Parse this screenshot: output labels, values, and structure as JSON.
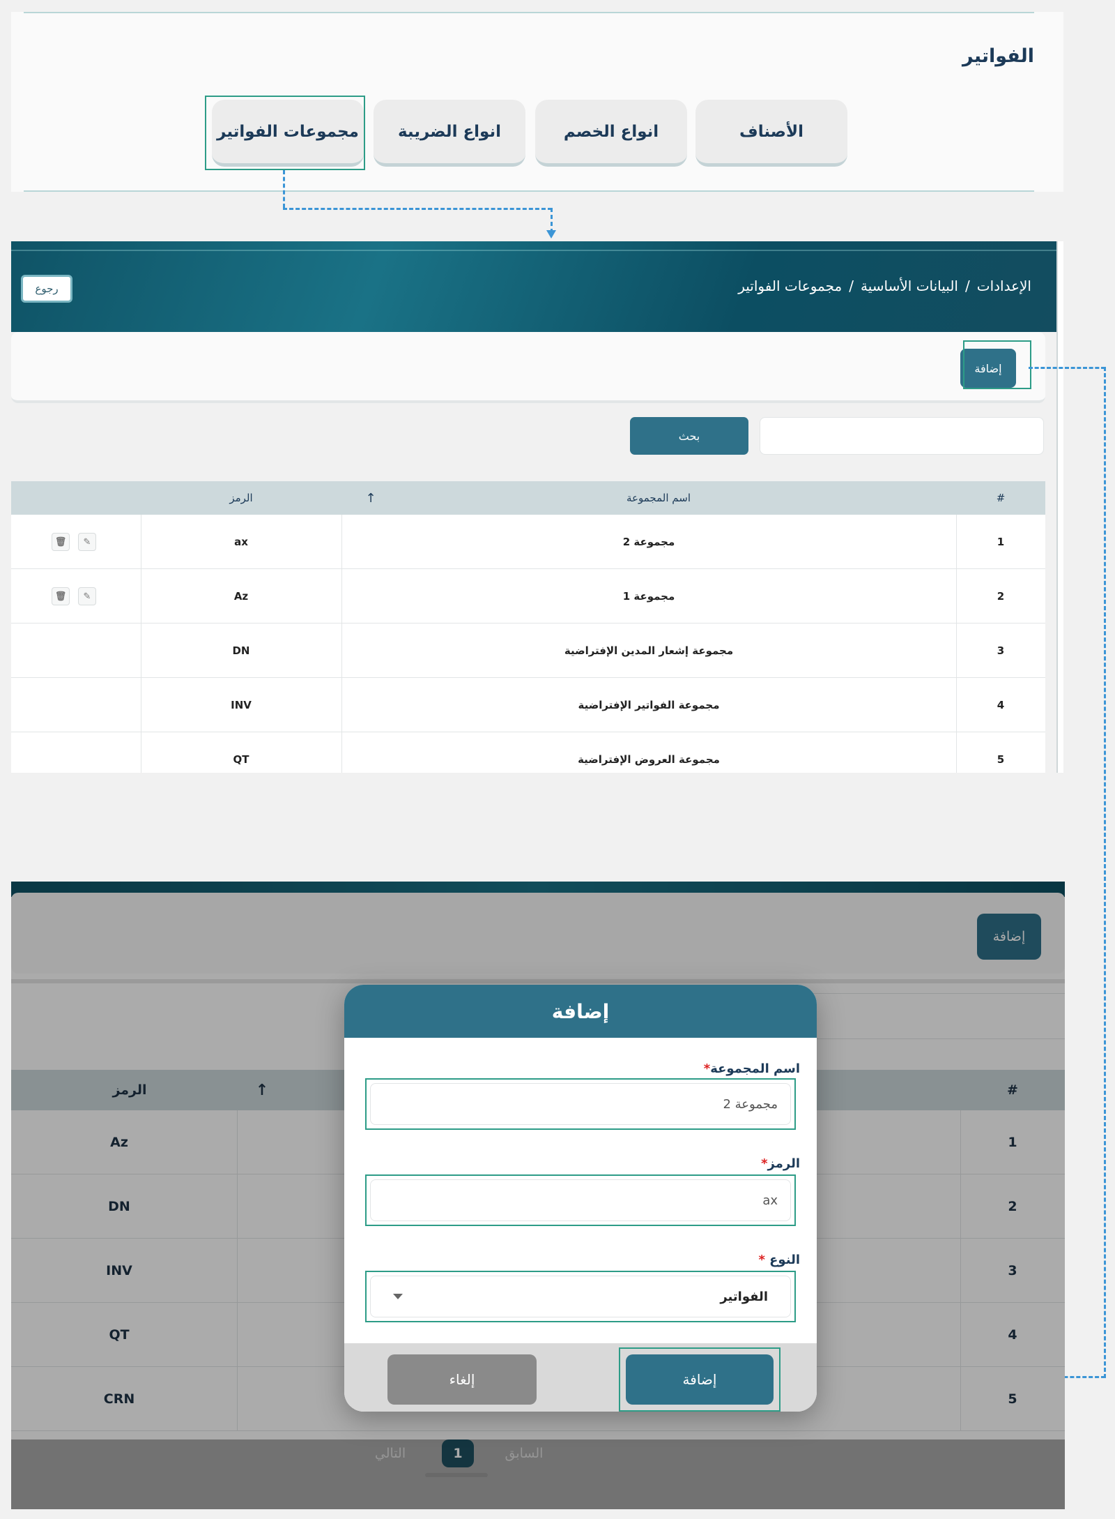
{
  "section1": {
    "title": "الفواتير",
    "tabs": [
      "الأصناف",
      "انواع الخصم",
      "انواع الضريبة",
      "مجموعات الفواتير"
    ]
  },
  "section2": {
    "breadcrumb": [
      "الإعدادات",
      "البيانات الأساسية",
      "مجموعات الفواتير"
    ],
    "breadcrumb_sep": "/",
    "back_label": "رجوع",
    "add_label": "إضافة",
    "search_label": "بحث",
    "search_placeholder": "",
    "columns": {
      "index": "#",
      "name": "اسم المجموعة",
      "sort_icon": "↑",
      "code": "الرمز"
    },
    "rows": [
      {
        "index": "1",
        "name": "مجموعة 2",
        "code": "ax",
        "actions": true
      },
      {
        "index": "2",
        "name": "مجموعة 1",
        "code": "Az",
        "actions": true
      },
      {
        "index": "3",
        "name": "مجموعة إشعار المدين الإفتراضية",
        "code": "DN",
        "actions": false
      },
      {
        "index": "4",
        "name": "مجموعة الفواتير الإفتراضية",
        "code": "INV",
        "actions": false
      },
      {
        "index": "5",
        "name": "مجموعة العروض الإفتراضية",
        "code": "QT",
        "actions": false
      }
    ]
  },
  "section3": {
    "add_label": "إضافة",
    "columns": {
      "index": "#",
      "sort_icon": "↑",
      "code": "الرمز"
    },
    "rows": [
      {
        "index": "1",
        "code": "Az"
      },
      {
        "index": "2",
        "code": "DN"
      },
      {
        "index": "3",
        "code": "INV"
      },
      {
        "index": "4",
        "code": "QT"
      },
      {
        "index": "5",
        "code": "CRN"
      }
    ],
    "pager": {
      "prev": "السابق",
      "page": "1",
      "next": "التالي"
    }
  },
  "modal": {
    "title": "إضافة",
    "fields": [
      {
        "label": "اسم المجموعة",
        "required_mark": "*",
        "value": "مجموعة 2"
      },
      {
        "label": "الرمز",
        "required_mark": "*",
        "value": "ax"
      },
      {
        "label": "النوع",
        "required_mark": "*",
        "value": "الفواتير"
      }
    ],
    "save_label": "إضافة",
    "cancel_label": "إلغاء"
  },
  "colors": {
    "primary": "#2f7189",
    "highlight": "#2d9c87",
    "connector": "#3b95d6"
  }
}
